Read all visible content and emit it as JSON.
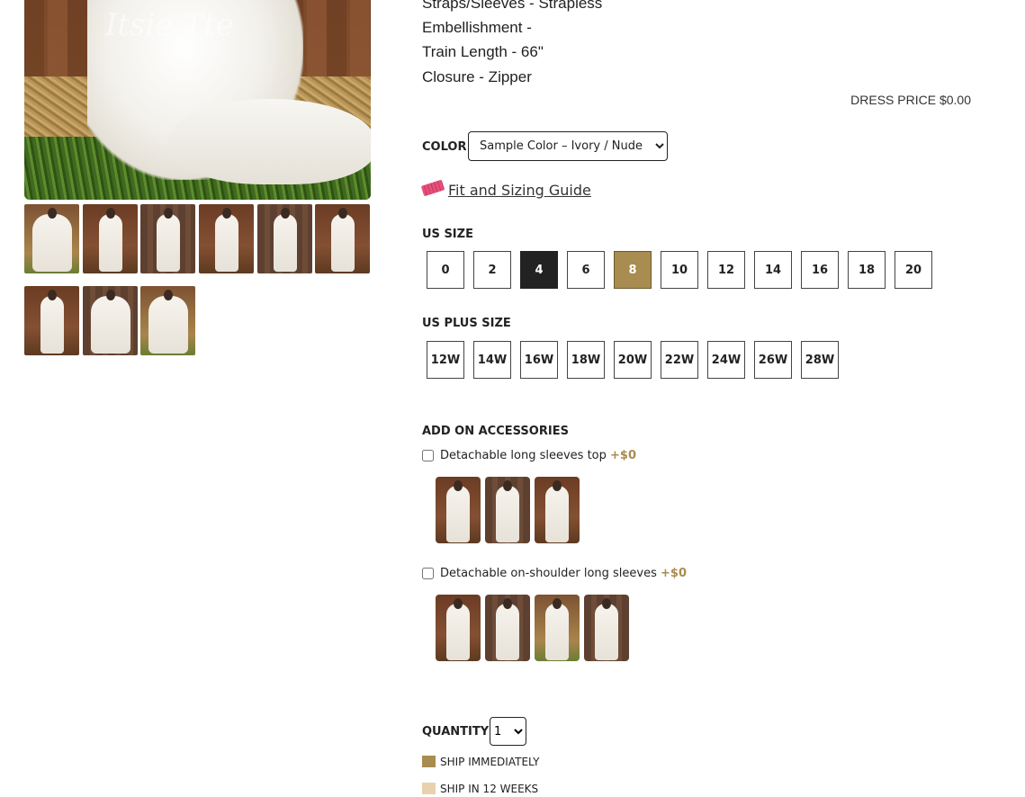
{
  "main_photo": {
    "watermark": "Itsie Tte"
  },
  "specs": [
    "Straps/Sleeves - Strapless",
    "Embellishment -",
    "Train Length - 66\"",
    "Closure - Zipper"
  ],
  "price": {
    "text": "DRESS PRICE $0.00"
  },
  "color": {
    "label": "COLOR",
    "selected": "Sample Color – Ivory / Nude",
    "options": [
      "Sample Color – Ivory / Nude"
    ]
  },
  "fit_guide": {
    "icon": "ruler-icon",
    "label": "Fit and Sizing Guide"
  },
  "us_size": {
    "label": "US SIZE",
    "sizes": [
      {
        "label": "0",
        "status": "available"
      },
      {
        "label": "2",
        "status": "available"
      },
      {
        "label": "4",
        "status": "unavailable"
      },
      {
        "label": "6",
        "status": "available"
      },
      {
        "label": "8",
        "status": "ship-immediately"
      },
      {
        "label": "10",
        "status": "available"
      },
      {
        "label": "12",
        "status": "available"
      },
      {
        "label": "14",
        "status": "available"
      },
      {
        "label": "16",
        "status": "available"
      },
      {
        "label": "18",
        "status": "available"
      },
      {
        "label": "20",
        "status": "available"
      }
    ]
  },
  "us_plus_size": {
    "label": "US PLUS SIZE",
    "sizes": [
      "12W",
      "14W",
      "16W",
      "18W",
      "20W",
      "22W",
      "24W",
      "26W",
      "28W"
    ]
  },
  "accessories": {
    "label": "ADD ON ACCESSORIES",
    "items": [
      {
        "name": "Detachable long sleeves top",
        "price": "+$0",
        "thumb_count": 3
      },
      {
        "name": "Detachable on-shoulder long sleeves",
        "price": "+$0",
        "thumb_count": 4
      }
    ]
  },
  "quantity": {
    "label": "QUANTITY",
    "value": "1",
    "options": [
      "1"
    ]
  },
  "legend": [
    {
      "label": "SHIP IMMEDIATELY",
      "color": "#a88c50"
    },
    {
      "label": "SHIP IN 12 WEEKS",
      "color": "#e8d2ae"
    }
  ],
  "colors": {
    "accent_gold": "#a88c50",
    "dark": "#222222"
  }
}
